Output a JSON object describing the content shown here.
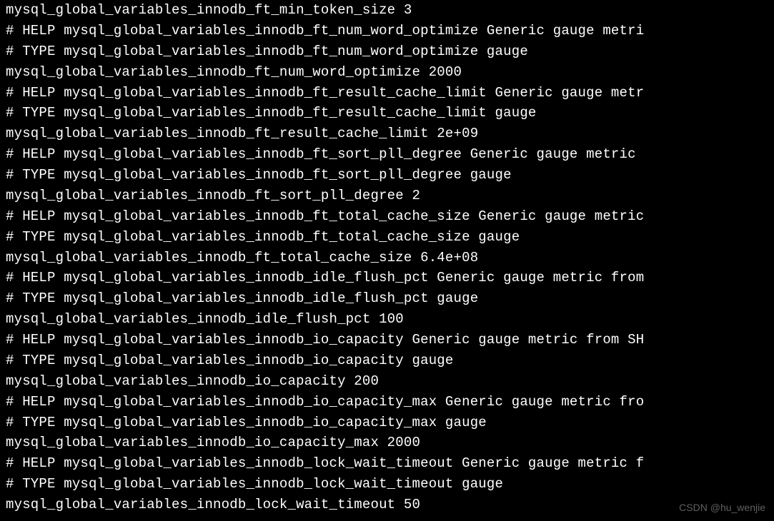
{
  "lines": [
    "mysql_global_variables_innodb_ft_min_token_size 3",
    "# HELP mysql_global_variables_innodb_ft_num_word_optimize Generic gauge metri",
    "# TYPE mysql_global_variables_innodb_ft_num_word_optimize gauge",
    "mysql_global_variables_innodb_ft_num_word_optimize 2000",
    "# HELP mysql_global_variables_innodb_ft_result_cache_limit Generic gauge metr",
    "# TYPE mysql_global_variables_innodb_ft_result_cache_limit gauge",
    "mysql_global_variables_innodb_ft_result_cache_limit 2e+09",
    "# HELP mysql_global_variables_innodb_ft_sort_pll_degree Generic gauge metric ",
    "# TYPE mysql_global_variables_innodb_ft_sort_pll_degree gauge",
    "mysql_global_variables_innodb_ft_sort_pll_degree 2",
    "# HELP mysql_global_variables_innodb_ft_total_cache_size Generic gauge metric",
    "# TYPE mysql_global_variables_innodb_ft_total_cache_size gauge",
    "mysql_global_variables_innodb_ft_total_cache_size 6.4e+08",
    "# HELP mysql_global_variables_innodb_idle_flush_pct Generic gauge metric from",
    "# TYPE mysql_global_variables_innodb_idle_flush_pct gauge",
    "mysql_global_variables_innodb_idle_flush_pct 100",
    "# HELP mysql_global_variables_innodb_io_capacity Generic gauge metric from SH",
    "# TYPE mysql_global_variables_innodb_io_capacity gauge",
    "mysql_global_variables_innodb_io_capacity 200",
    "# HELP mysql_global_variables_innodb_io_capacity_max Generic gauge metric fro",
    "# TYPE mysql_global_variables_innodb_io_capacity_max gauge",
    "mysql_global_variables_innodb_io_capacity_max 2000",
    "# HELP mysql_global_variables_innodb_lock_wait_timeout Generic gauge metric f",
    "# TYPE mysql_global_variables_innodb_lock_wait_timeout gauge",
    "mysql_global_variables_innodb_lock_wait_timeout 50"
  ],
  "watermark": "CSDN @hu_wenjie"
}
